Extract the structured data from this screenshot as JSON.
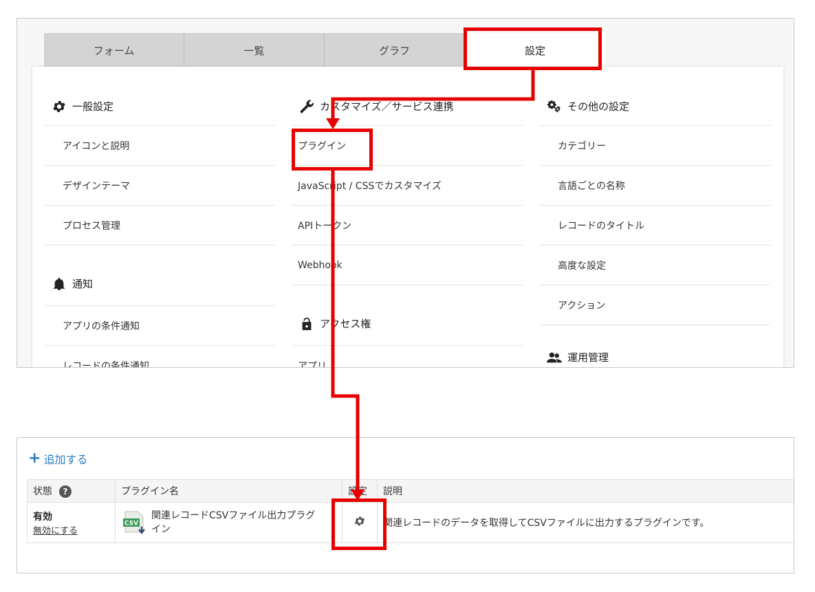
{
  "tabs": [
    {
      "label": "フォーム"
    },
    {
      "label": "一覧"
    },
    {
      "label": "グラフ"
    },
    {
      "label": "設定",
      "active": true
    }
  ],
  "sections": {
    "general": {
      "title": "一般設定",
      "icon": "gear-icon",
      "items": [
        "アイコンと説明",
        "デザインテーマ",
        "プロセス管理"
      ]
    },
    "notification": {
      "title": "通知",
      "icon": "bell-icon",
      "items": [
        "アプリの条件通知",
        "レコードの条件通知"
      ]
    },
    "customize": {
      "title": "カスタマイズ／サービス連携",
      "icon": "wrench-icon",
      "items": [
        "プラグイン",
        "JavaScript / CSSでカスタマイズ",
        "APIトークン",
        "Webhook"
      ]
    },
    "access": {
      "title": "アクセス権",
      "icon": "lock-icon",
      "items": [
        "アプリ"
      ]
    },
    "other": {
      "title": "その他の設定",
      "icon": "gears-icon",
      "items": [
        "カテゴリー",
        "言語ごとの名称",
        "レコードのタイトル",
        "高度な設定",
        "アクション"
      ]
    },
    "operations": {
      "title": "運用管理",
      "icon": "people-icon"
    }
  },
  "plugins": {
    "add_label": "追加する",
    "columns": {
      "status": "状態",
      "name": "プラグイン名",
      "settings": "設定",
      "description": "説明"
    },
    "rows": [
      {
        "status": "有効",
        "toggle_label": "無効にする",
        "name": "関連レコードCSVファイル出力プラグイン",
        "icon_text": "CSV",
        "description": "関連レコードのデータを取得してCSVファイルに出力するプラグインです。"
      }
    ]
  },
  "colors": {
    "annotation": "#e60000",
    "link": "#2a7bc1",
    "tab_inactive": "#d4d4d4"
  }
}
